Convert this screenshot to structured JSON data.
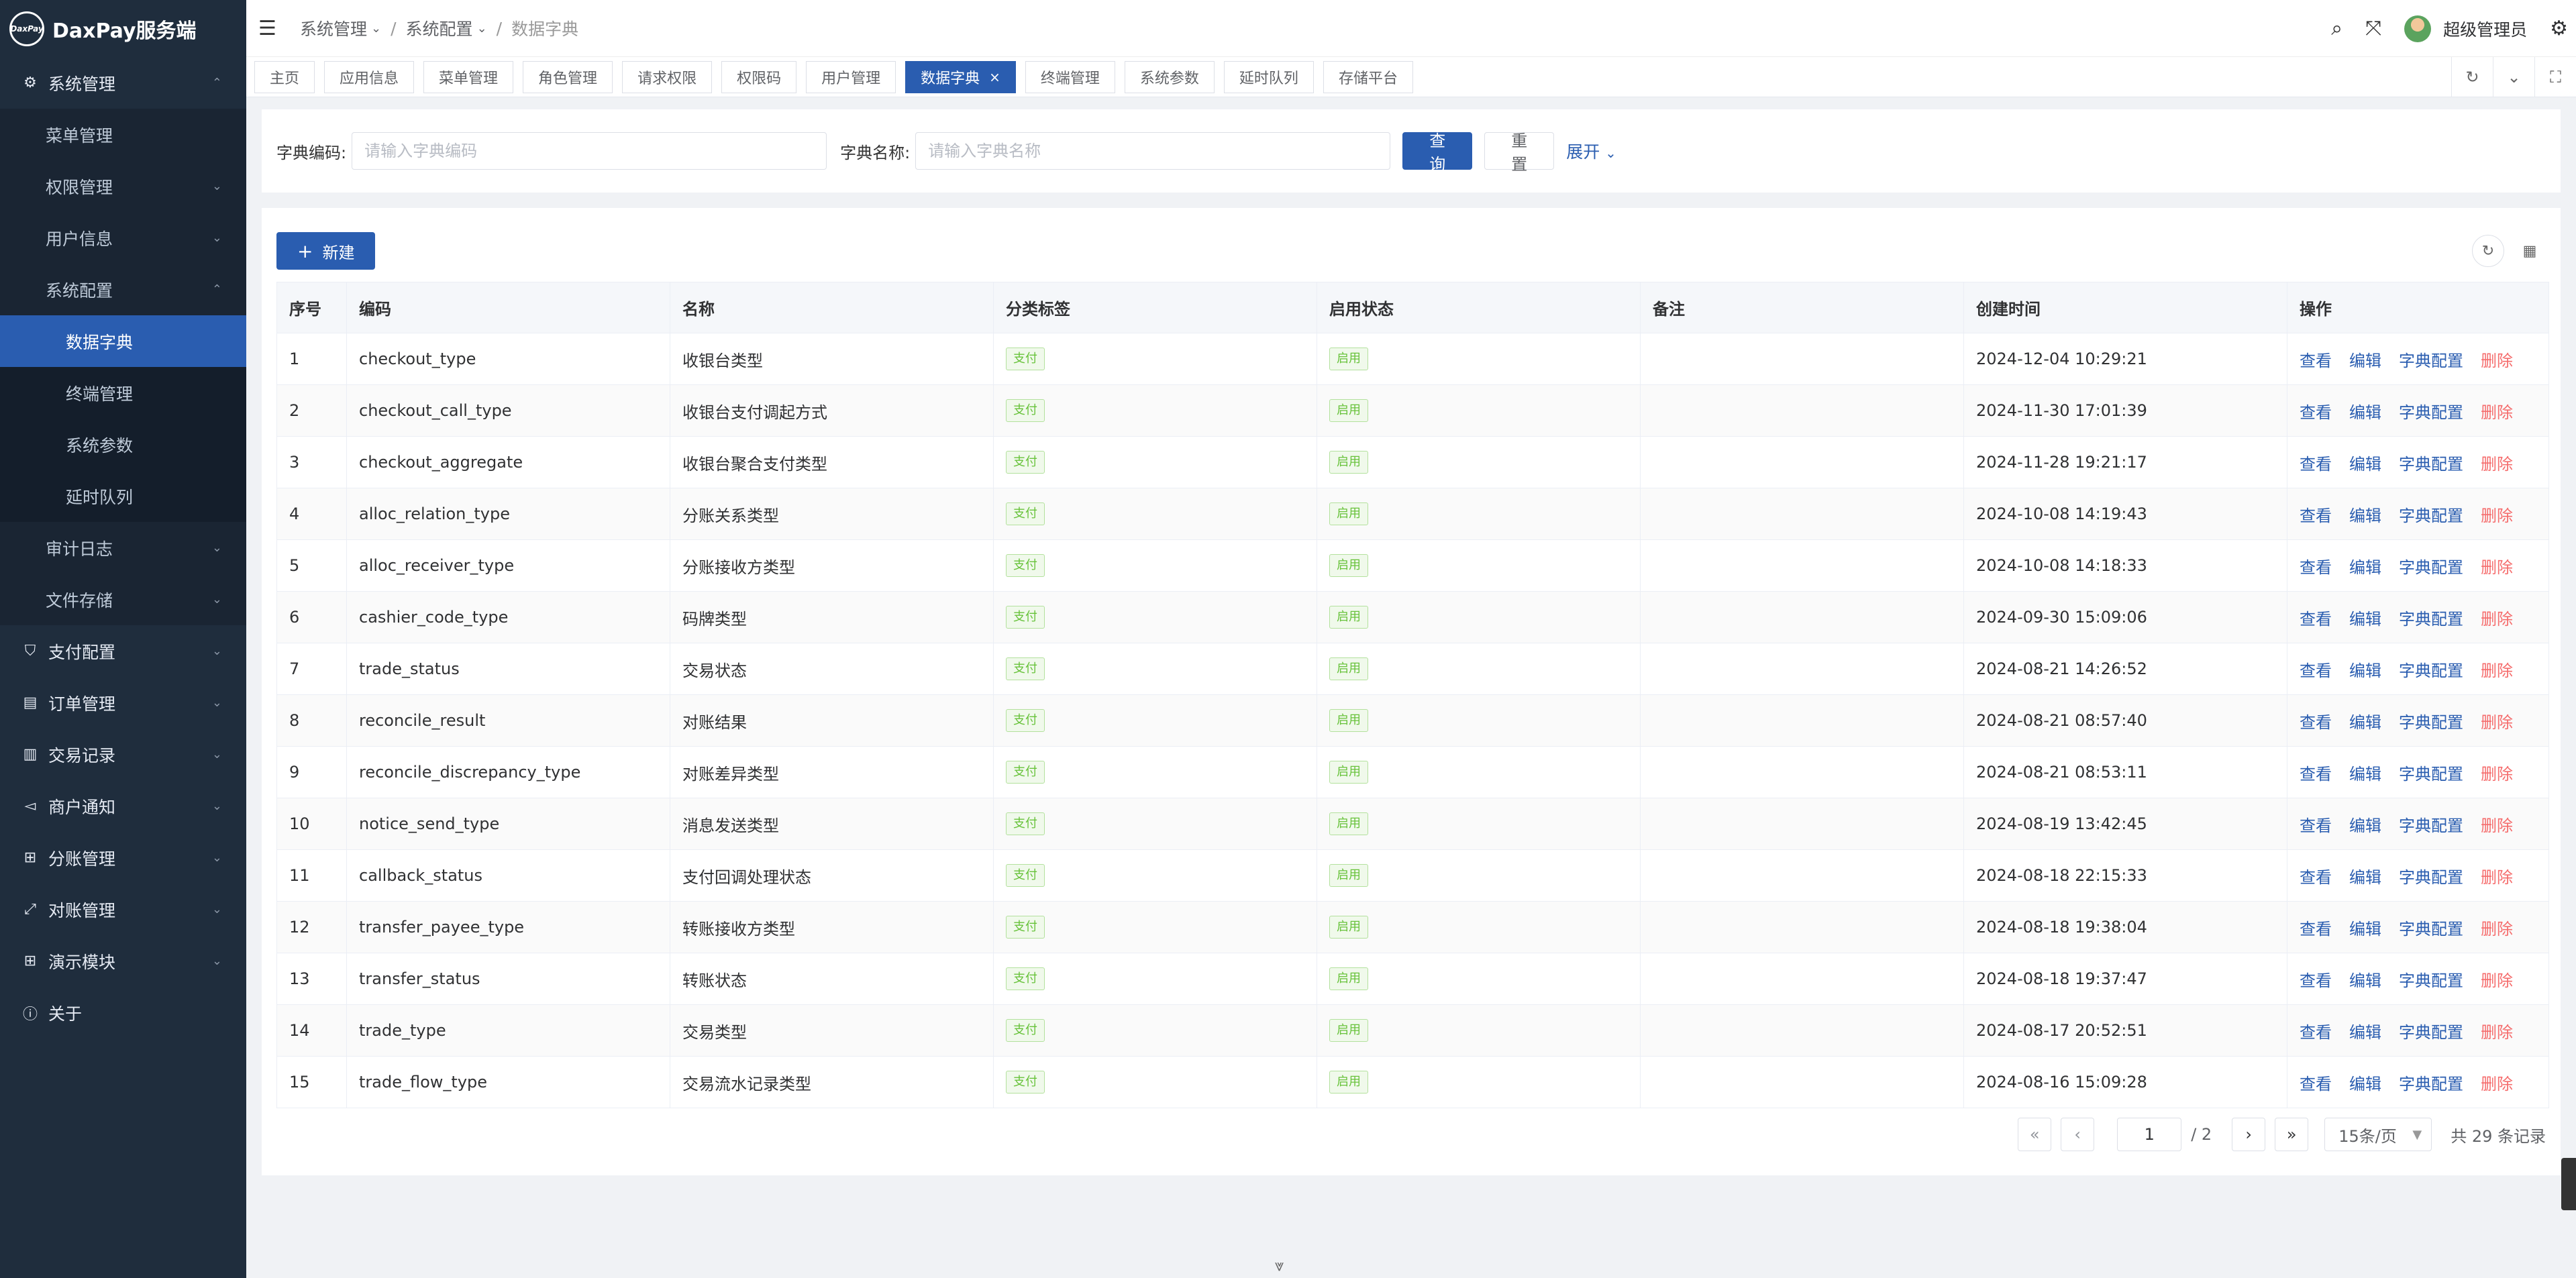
{
  "app": {
    "title": "DaxPay服务端",
    "logo_text": "DaxPay"
  },
  "sidebar": {
    "items": [
      {
        "label": "系统管理",
        "level": 1,
        "icon": "gear-icon",
        "glyph": "⚙",
        "arrow": "⌃",
        "expanded": true
      },
      {
        "label": "菜单管理",
        "level": 2,
        "arrow": ""
      },
      {
        "label": "权限管理",
        "level": 2,
        "arrow": "⌄"
      },
      {
        "label": "用户信息",
        "level": 2,
        "arrow": "⌄"
      },
      {
        "label": "系统配置",
        "level": 2,
        "arrow": "⌃",
        "expanded": true
      },
      {
        "label": "数据字典",
        "level": 3,
        "arrow": "",
        "active": true
      },
      {
        "label": "终端管理",
        "level": 3,
        "arrow": ""
      },
      {
        "label": "系统参数",
        "level": 3,
        "arrow": ""
      },
      {
        "label": "延时队列",
        "level": 3,
        "arrow": ""
      },
      {
        "label": "审计日志",
        "level": 2,
        "arrow": "⌄"
      },
      {
        "label": "文件存储",
        "level": 2,
        "arrow": "⌄"
      },
      {
        "label": "支付配置",
        "level": 1,
        "icon": "shield-icon",
        "glyph": "⛉",
        "arrow": "⌄"
      },
      {
        "label": "订单管理",
        "level": 1,
        "icon": "order-icon",
        "glyph": "▤",
        "arrow": "⌄"
      },
      {
        "label": "交易记录",
        "level": 1,
        "icon": "record-icon",
        "glyph": "▥",
        "arrow": "⌄"
      },
      {
        "label": "商户通知",
        "level": 1,
        "icon": "notice-icon",
        "glyph": "◅",
        "arrow": "⌄"
      },
      {
        "label": "分账管理",
        "level": 1,
        "icon": "split-icon",
        "glyph": "⊞",
        "arrow": "⌄"
      },
      {
        "label": "对账管理",
        "level": 1,
        "icon": "reconcile-icon",
        "glyph": "⤢",
        "arrow": "⌄"
      },
      {
        "label": "演示模块",
        "level": 1,
        "icon": "grid-icon",
        "glyph": "⊞",
        "arrow": "⌄"
      },
      {
        "label": "关于",
        "level": 1,
        "icon": "info-icon",
        "glyph": "ⓘ",
        "arrow": ""
      }
    ]
  },
  "header": {
    "breadcrumb": [
      "系统管理",
      "系统配置",
      "数据字典"
    ],
    "username": "超级管理员"
  },
  "tabs": [
    {
      "label": "主页"
    },
    {
      "label": "应用信息"
    },
    {
      "label": "菜单管理"
    },
    {
      "label": "角色管理"
    },
    {
      "label": "请求权限"
    },
    {
      "label": "权限码"
    },
    {
      "label": "用户管理"
    },
    {
      "label": "数据字典",
      "active": true
    },
    {
      "label": "终端管理"
    },
    {
      "label": "系统参数"
    },
    {
      "label": "延时队列"
    },
    {
      "label": "存储平台"
    }
  ],
  "search": {
    "code_label": "字典编码:",
    "code_placeholder": "请输入字典编码",
    "name_label": "字典名称:",
    "name_placeholder": "请输入字典名称",
    "query_label": "查询",
    "reset_label": "重置",
    "expand_label": "展开"
  },
  "toolbar": {
    "new_label": "新建"
  },
  "table": {
    "columns": [
      "序号",
      "编码",
      "名称",
      "分类标签",
      "启用状态",
      "备注",
      "创建时间",
      "操作"
    ],
    "actions": {
      "view": "查看",
      "edit": "编辑",
      "config": "字典配置",
      "delete": "删除"
    },
    "rows": [
      {
        "no": "1",
        "code": "checkout_type",
        "name": "收银台类型",
        "tag": "支付",
        "status": "启用",
        "remark": "",
        "created": "2024-12-04 10:29:21"
      },
      {
        "no": "2",
        "code": "checkout_call_type",
        "name": "收银台支付调起方式",
        "tag": "支付",
        "status": "启用",
        "remark": "",
        "created": "2024-11-30 17:01:39"
      },
      {
        "no": "3",
        "code": "checkout_aggregate",
        "name": "收银台聚合支付类型",
        "tag": "支付",
        "status": "启用",
        "remark": "",
        "created": "2024-11-28 19:21:17"
      },
      {
        "no": "4",
        "code": "alloc_relation_type",
        "name": "分账关系类型",
        "tag": "支付",
        "status": "启用",
        "remark": "",
        "created": "2024-10-08 14:19:43"
      },
      {
        "no": "5",
        "code": "alloc_receiver_type",
        "name": "分账接收方类型",
        "tag": "支付",
        "status": "启用",
        "remark": "",
        "created": "2024-10-08 14:18:33"
      },
      {
        "no": "6",
        "code": "cashier_code_type",
        "name": "码牌类型",
        "tag": "支付",
        "status": "启用",
        "remark": "",
        "created": "2024-09-30 15:09:06"
      },
      {
        "no": "7",
        "code": "trade_status",
        "name": "交易状态",
        "tag": "支付",
        "status": "启用",
        "remark": "",
        "created": "2024-08-21 14:26:52"
      },
      {
        "no": "8",
        "code": "reconcile_result",
        "name": "对账结果",
        "tag": "支付",
        "status": "启用",
        "remark": "",
        "created": "2024-08-21 08:57:40"
      },
      {
        "no": "9",
        "code": "reconcile_discrepancy_type",
        "name": "对账差异类型",
        "tag": "支付",
        "status": "启用",
        "remark": "",
        "created": "2024-08-21 08:53:11"
      },
      {
        "no": "10",
        "code": "notice_send_type",
        "name": "消息发送类型",
        "tag": "支付",
        "status": "启用",
        "remark": "",
        "created": "2024-08-19 13:42:45"
      },
      {
        "no": "11",
        "code": "callback_status",
        "name": "支付回调处理状态",
        "tag": "支付",
        "status": "启用",
        "remark": "",
        "created": "2024-08-18 22:15:33"
      },
      {
        "no": "12",
        "code": "transfer_payee_type",
        "name": "转账接收方类型",
        "tag": "支付",
        "status": "启用",
        "remark": "",
        "created": "2024-08-18 19:38:04"
      },
      {
        "no": "13",
        "code": "transfer_status",
        "name": "转账状态",
        "tag": "支付",
        "status": "启用",
        "remark": "",
        "created": "2024-08-18 19:37:47"
      },
      {
        "no": "14",
        "code": "trade_type",
        "name": "交易类型",
        "tag": "支付",
        "status": "启用",
        "remark": "",
        "created": "2024-08-17 20:52:51"
      },
      {
        "no": "15",
        "code": "trade_flow_type",
        "name": "交易流水记录类型",
        "tag": "支付",
        "status": "启用",
        "remark": "",
        "created": "2024-08-16 15:09:28"
      }
    ]
  },
  "pagination": {
    "current": "1",
    "total_pages": "/ 2",
    "page_size": "15条/页",
    "total_text": "共 29 条记录"
  },
  "colors": {
    "primary": "#2a5db0",
    "sidebar_bg": "#1f2d3d",
    "danger": "#f56c6c",
    "tag_green": "#67c23a"
  }
}
